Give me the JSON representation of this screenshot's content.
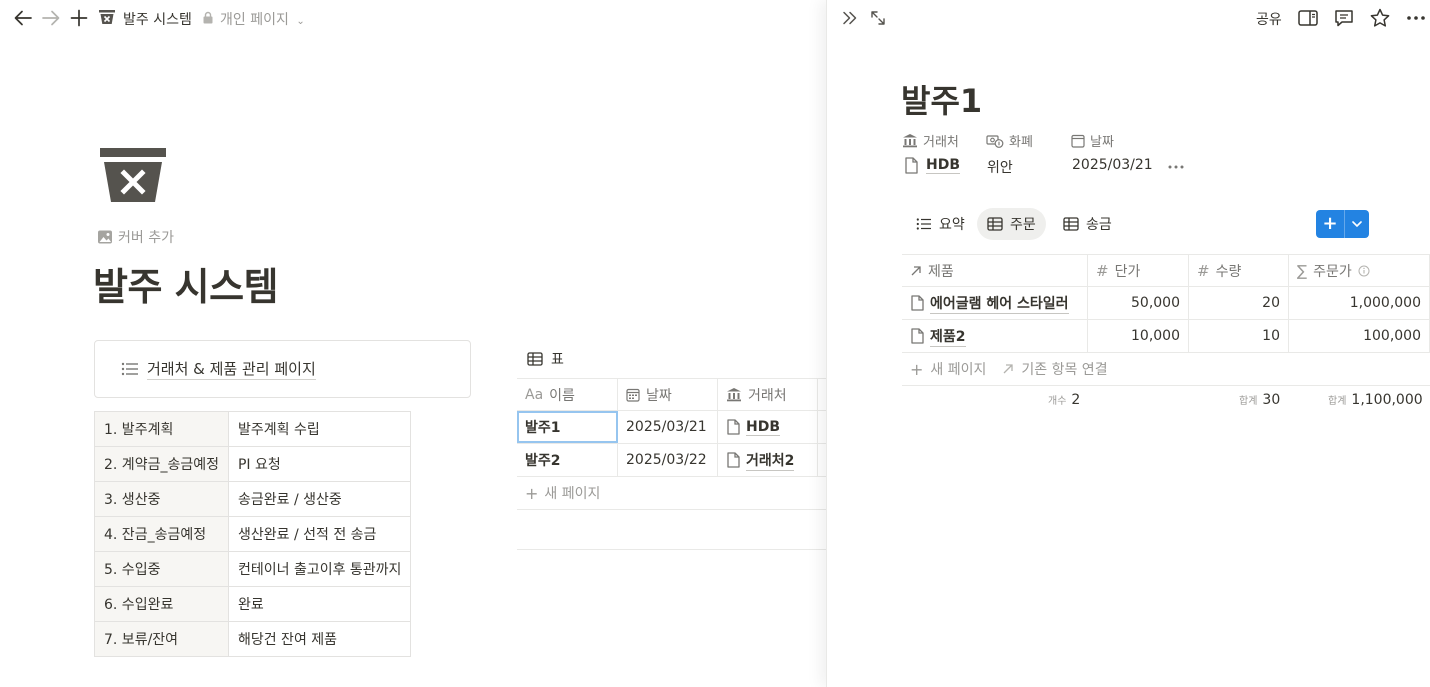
{
  "breadcrumb": {
    "title": "발주 시스템",
    "privacy": "개인 페이지"
  },
  "page": {
    "add_cover": "커버 추가",
    "title": "발주 시스템",
    "link_card": "거래처 & 제품 관리 페이지",
    "stages": [
      {
        "key": "1. 발주계획",
        "value": "발주계획 수립"
      },
      {
        "key": "2. 계약금_송금예정",
        "value": "PI 요청"
      },
      {
        "key": "3. 생산중",
        "value": "송금완료 / 생산중"
      },
      {
        "key": "4. 잔금_송금예정",
        "value": "생산완료 / 선적 전 송금"
      },
      {
        "key": "5. 수입중",
        "value": "컨테이너 출고이후 통관까지"
      },
      {
        "key": "6. 수입완료",
        "value": "완료"
      },
      {
        "key": "7. 보류/잔여",
        "value": "해당건 잔여 제품"
      }
    ]
  },
  "orders_db": {
    "view_label": "표",
    "columns": {
      "name_prefix": "Aa",
      "name": "이름",
      "date": "날짜",
      "vendor": "거래처"
    },
    "rows": [
      {
        "name": "발주1",
        "date": "2025/03/21",
        "vendor": "HDB"
      },
      {
        "name": "발주2",
        "date": "2025/03/22",
        "vendor": "거래처2"
      }
    ],
    "new_page": "새 페이지"
  },
  "panel": {
    "share": "공유",
    "title": "발주1",
    "props": {
      "vendor_label": "거래처",
      "currency_label": "화폐",
      "date_label": "날짜",
      "vendor_value": "HDB",
      "currency_value": "위안",
      "date_value": "2025/03/21"
    },
    "tabs": [
      {
        "label": "요약",
        "active": false
      },
      {
        "label": "주문",
        "active": true
      },
      {
        "label": "송금",
        "active": false
      }
    ],
    "new_button": "+",
    "items": {
      "columns": {
        "product": "제품",
        "unit_price": "단가",
        "quantity": "수량",
        "order_price": "주문가"
      },
      "rows": [
        {
          "product": "에어글램 헤어 스타일러",
          "unit_price": "50,000",
          "quantity": "20",
          "order_price": "1,000,000"
        },
        {
          "product": "제품2",
          "unit_price": "10,000",
          "quantity": "10",
          "order_price": "100,000"
        }
      ],
      "new_page": "새 페이지",
      "link_existing": "기존 항목 연결",
      "footer": {
        "count_label": "개수",
        "count_value": "2",
        "qty_label": "합계",
        "qty_value": "30",
        "total_label": "합계",
        "total_value": "1,100,000"
      }
    }
  },
  "colors": {
    "accent": "#2383e2",
    "text": "#37352f",
    "muted": "#9b9a97",
    "border": "#e9e9e7"
  }
}
